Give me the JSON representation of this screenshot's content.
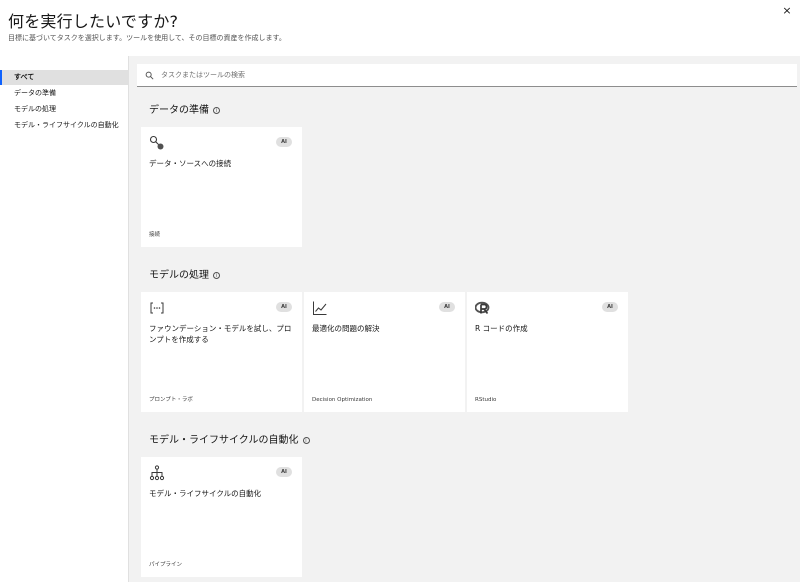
{
  "header": {
    "title": "何を実行したいですか?",
    "subtitle": "目標に基づいてタスクを選択します。ツールを使用して、その目標の資産を作成します。",
    "close_glyph": "×"
  },
  "sidebar": {
    "items": [
      {
        "label": "すべて",
        "active": true
      },
      {
        "label": "データの準備",
        "active": false
      },
      {
        "label": "モデルの処理",
        "active": false
      },
      {
        "label": "モデル・ライフサイクルの自動化",
        "active": false
      }
    ]
  },
  "search": {
    "placeholder": "タスクまたはツールの検索",
    "value": ""
  },
  "sections": [
    {
      "title": "データの準備",
      "info_icon": "information-icon",
      "cards": [
        {
          "icon": "connection-icon",
          "badge": "AI",
          "title": "データ・ソースへの接続",
          "footer": "接続"
        }
      ]
    },
    {
      "title": "モデルの処理",
      "info_icon": "information-icon",
      "cards": [
        {
          "icon": "prompt-lab-icon",
          "badge": "AI",
          "title": "ファウンデーション・モデルを試し、プロンプトを作成する",
          "footer": "プロンプト・ラボ"
        },
        {
          "icon": "chart-line-icon",
          "badge": "AI",
          "title": "最適化の問題の解決",
          "footer": "Decision Optimization"
        },
        {
          "icon": "r-language-icon",
          "badge": "AI",
          "title": "R コードの作成",
          "footer": "RStudio"
        }
      ]
    },
    {
      "title": "モデル・ライフサイクルの自動化",
      "info_icon": "information-icon",
      "cards": [
        {
          "icon": "pipeline-icon",
          "badge": "AI",
          "title": "モデル・ライフサイクルの自動化",
          "footer": "パイプライン"
        }
      ]
    }
  ],
  "colors": {
    "accent": "#0f62fe",
    "background": "#f2f2f2",
    "card": "#ffffff",
    "badge": "#e0e0e0"
  }
}
